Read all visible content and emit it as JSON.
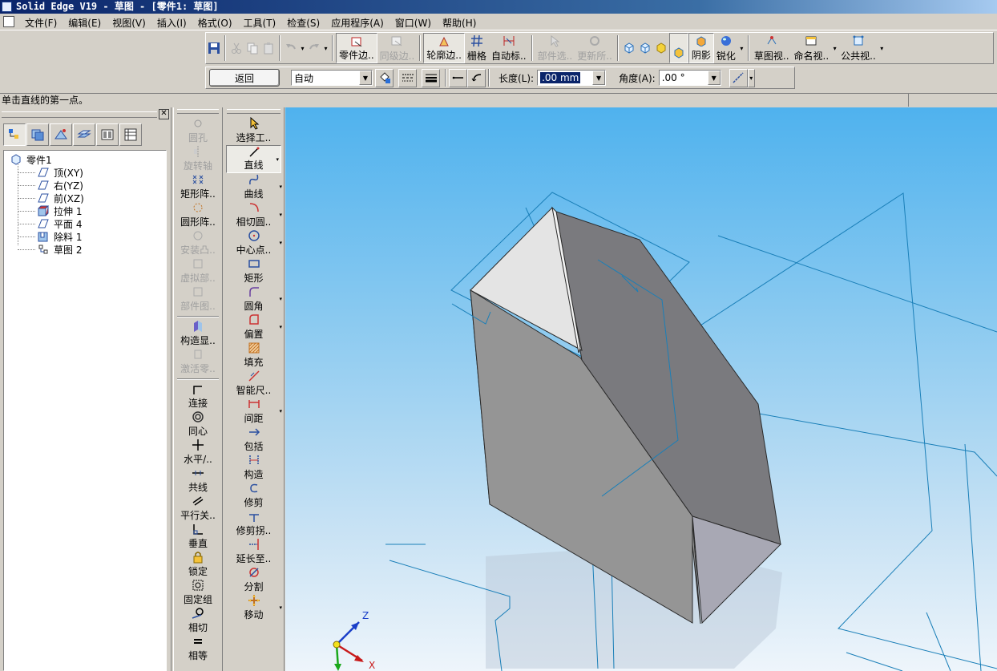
{
  "window": {
    "title": "Solid Edge V19 - 草图 - [零件1: 草图]"
  },
  "menu": {
    "items": [
      "文件(F)",
      "编辑(E)",
      "视图(V)",
      "插入(I)",
      "格式(O)",
      "工具(T)",
      "检查(S)",
      "应用程序(A)",
      "窗口(W)",
      "帮助(H)"
    ]
  },
  "toolbar": {
    "part_edges": "零件边..",
    "peer_edges": "同级边..",
    "contour_edges": "轮廓边..",
    "grid": "栅格",
    "auto_dim": "自动标..",
    "part_select": "部件选..",
    "update_all": "更新所..",
    "shading": "阴影",
    "sharpen": "锐化",
    "sketch_view": "草图视..",
    "named_view": "命名视..",
    "common_view": "公共视.."
  },
  "ribbon": {
    "back_label": "返回",
    "mode_value": "自动",
    "length_label": "长度(L):",
    "length_value": ".00 mm",
    "angle_label": "角度(A):",
    "angle_value": ".00 °"
  },
  "prompt": {
    "text": "单击直线的第一点。"
  },
  "pathfinder": {
    "tree": [
      {
        "label": "零件1",
        "icon": "part-icon"
      },
      {
        "label": "顶(XY)",
        "icon": "plane-icon"
      },
      {
        "label": "右(YZ)",
        "icon": "plane-icon"
      },
      {
        "label": "前(XZ)",
        "icon": "plane-icon"
      },
      {
        "label": "拉伸 1",
        "icon": "extrude-icon"
      },
      {
        "label": "平面 4",
        "icon": "plane-icon"
      },
      {
        "label": "除料 1",
        "icon": "cutout-icon"
      },
      {
        "label": "草图 2",
        "icon": "sketch-icon"
      }
    ]
  },
  "features_bar": {
    "items": [
      {
        "label": "圆孔",
        "enabled": false
      },
      {
        "label": "旋转轴",
        "enabled": false
      },
      {
        "label": "矩形阵..",
        "enabled": true
      },
      {
        "label": "圆形阵..",
        "enabled": true
      },
      {
        "label": "安装凸..",
        "enabled": false
      },
      {
        "label": "虚拟部..",
        "enabled": false
      },
      {
        "label": "部件图..",
        "enabled": false
      },
      {
        "label": "构造显..",
        "enabled": true
      },
      {
        "label": "激活零..",
        "enabled": false
      },
      {
        "label": "连接",
        "enabled": true
      },
      {
        "label": "同心",
        "enabled": true
      },
      {
        "label": "水平/..",
        "enabled": true
      },
      {
        "label": "共线",
        "enabled": true
      },
      {
        "label": "平行关..",
        "enabled": true
      },
      {
        "label": "垂直",
        "enabled": true
      },
      {
        "label": "锁定",
        "enabled": true
      },
      {
        "label": "固定组",
        "enabled": true
      },
      {
        "label": "相切",
        "enabled": true
      },
      {
        "label": "相等",
        "enabled": true
      }
    ]
  },
  "draw_bar": {
    "items": [
      {
        "label": "选择工..",
        "more": false
      },
      {
        "label": "直线",
        "more": true
      },
      {
        "label": "曲线",
        "more": true
      },
      {
        "label": "相切圆..",
        "more": true
      },
      {
        "label": "中心点..",
        "more": true
      },
      {
        "label": "矩形",
        "more": false
      },
      {
        "label": "圆角",
        "more": true
      },
      {
        "label": "偏置",
        "more": true
      },
      {
        "label": "填充",
        "more": false
      },
      {
        "label": "智能尺..",
        "more": false
      },
      {
        "label": "间距",
        "more": true
      },
      {
        "label": "包括",
        "more": false
      },
      {
        "label": "构造",
        "more": false
      },
      {
        "label": "修剪",
        "more": false
      },
      {
        "label": "修剪拐..",
        "more": false
      },
      {
        "label": "延长至..",
        "more": false
      },
      {
        "label": "分割",
        "more": false
      },
      {
        "label": "移动",
        "more": true
      }
    ]
  },
  "viewport": {
    "triad": {
      "z": "Z",
      "x": "X"
    },
    "colors": {
      "sky_top": "#4fb2ee",
      "sky_bottom": "#eef5fb",
      "plane_lines": "#1a7fb8",
      "solid": "#8a8a8a"
    }
  }
}
